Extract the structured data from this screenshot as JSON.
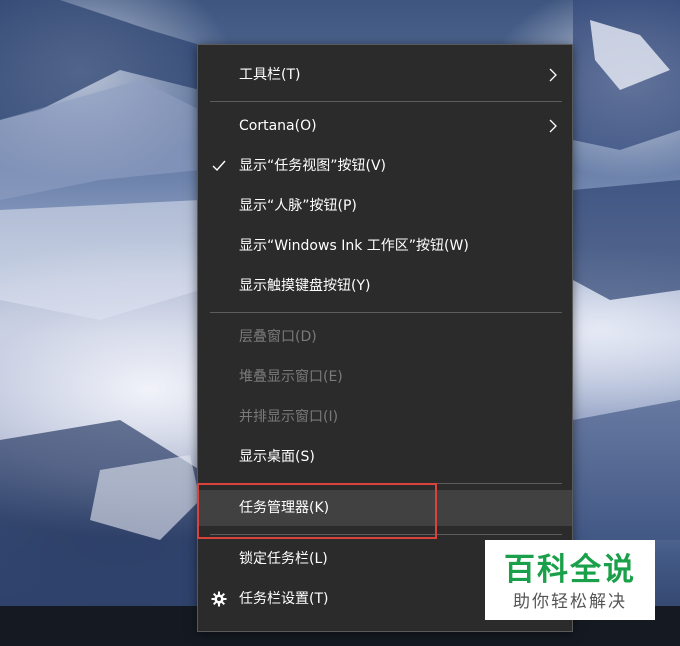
{
  "context_menu": {
    "items": [
      {
        "label": "工具栏(T)",
        "state": "normal",
        "submenu": true
      },
      {
        "label": "Cortana(O)",
        "state": "normal",
        "submenu": true
      },
      {
        "label": "显示“任务视图”按钮(V)",
        "state": "checked"
      },
      {
        "label": "显示“人脉”按钮(P)",
        "state": "normal"
      },
      {
        "label": "显示“Windows Ink 工作区”按钮(W)",
        "state": "normal"
      },
      {
        "label": "显示触摸键盘按钮(Y)",
        "state": "normal"
      },
      {
        "label": "层叠窗口(D)",
        "state": "disabled"
      },
      {
        "label": "堆叠显示窗口(E)",
        "state": "disabled"
      },
      {
        "label": "并排显示窗口(I)",
        "state": "disabled"
      },
      {
        "label": "显示桌面(S)",
        "state": "normal"
      },
      {
        "label": "任务管理器(K)",
        "state": "highlighted"
      },
      {
        "label": "锁定任务栏(L)",
        "state": "normal"
      },
      {
        "label": "任务栏设置(T)",
        "state": "normal",
        "icon": "gear-icon"
      }
    ]
  },
  "watermark": {
    "title": "百科全说",
    "subtitle": "助你轻松解决"
  },
  "colors": {
    "menu_bg": "#2b2b2b",
    "menu_text": "#ffffff",
    "disabled_text": "#7a7a7a",
    "hover_bg": "#414141",
    "highlight_border": "#d8433b",
    "watermark_green": "#1aa04a"
  }
}
